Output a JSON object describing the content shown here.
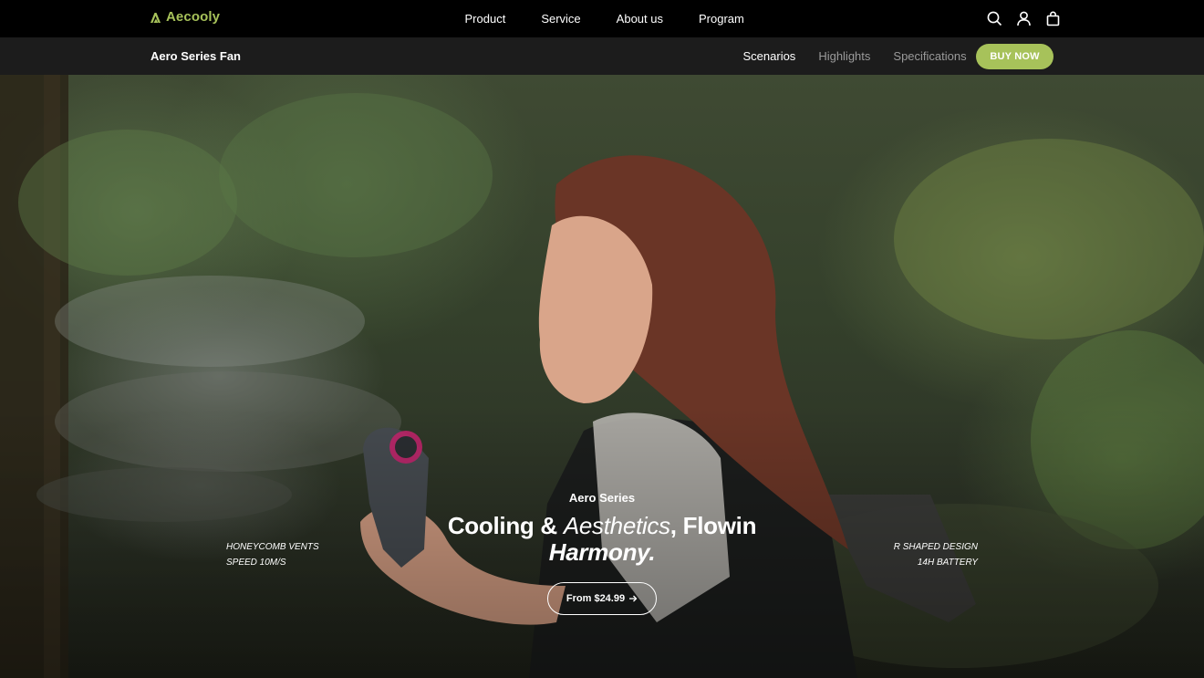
{
  "brand": {
    "name": "Aecooly",
    "accent": "#a7c25a",
    "logo_icon": "brand-mark-icon"
  },
  "nav": {
    "items": [
      {
        "label": "Product"
      },
      {
        "label": "Service"
      },
      {
        "label": "About us"
      },
      {
        "label": "Program"
      }
    ],
    "icons": [
      "search-icon",
      "user-icon",
      "shopping-bag-icon"
    ]
  },
  "subbar": {
    "product_name": "Aero Series Fan",
    "tabs": [
      {
        "label": "Scenarios",
        "active": true
      },
      {
        "label": "Highlights",
        "active": false
      },
      {
        "label": "Specifications",
        "active": false
      }
    ],
    "buy_label": "BUY NOW"
  },
  "hero": {
    "eyebrow": "Aero Series",
    "title_part1": "Cooling &",
    "title_part2": "Aesthetics",
    "title_part3": ", Flowin",
    "title_part4": "Harmony.",
    "price_label": "From $24.99",
    "price_icon": "arrow-right-icon",
    "specs_left": [
      "HONEYCOMB VENTS",
      "SPEED 10M/S"
    ],
    "specs_right": [
      "R SHAPED DESIGN",
      "14H BATTERY"
    ]
  }
}
